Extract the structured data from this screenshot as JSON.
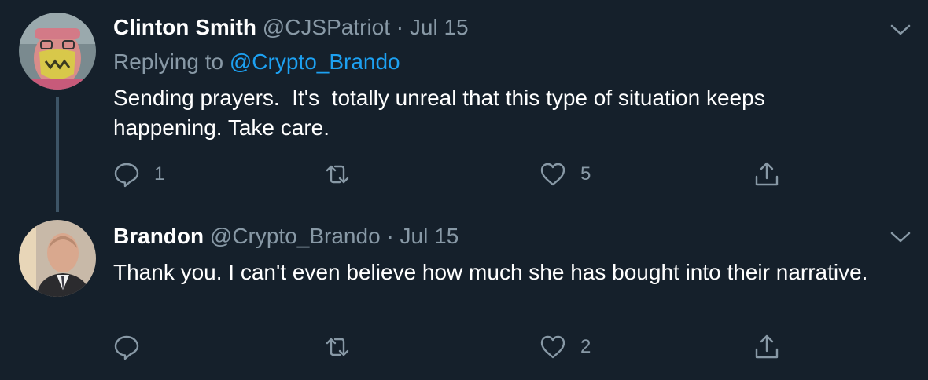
{
  "tweets": [
    {
      "author_name": "Clinton Smith",
      "handle": "@CJSPatriot",
      "separator": "·",
      "date": "Jul 15",
      "replying_prefix": "Replying to",
      "replying_handle": "@Crypto_Brando",
      "text": "Sending prayers.  It's  totally unreal that this type of situation keeps happening. Take care.",
      "reply_count": "1",
      "like_count": "5"
    },
    {
      "author_name": "Brandon",
      "handle": "@Crypto_Brando",
      "separator": "·",
      "date": "Jul 15",
      "text": "Thank you. I can't even believe how much she has bought into their narrative.",
      "reply_count": "",
      "like_count": "2"
    }
  ],
  "colors": {
    "background": "#15202b",
    "muted": "#8899a6",
    "link": "#1da1f2",
    "thread_line": "#3d5466"
  },
  "icons": [
    "reply-icon",
    "retweet-icon",
    "like-icon",
    "share-icon",
    "chevron-down-icon"
  ]
}
